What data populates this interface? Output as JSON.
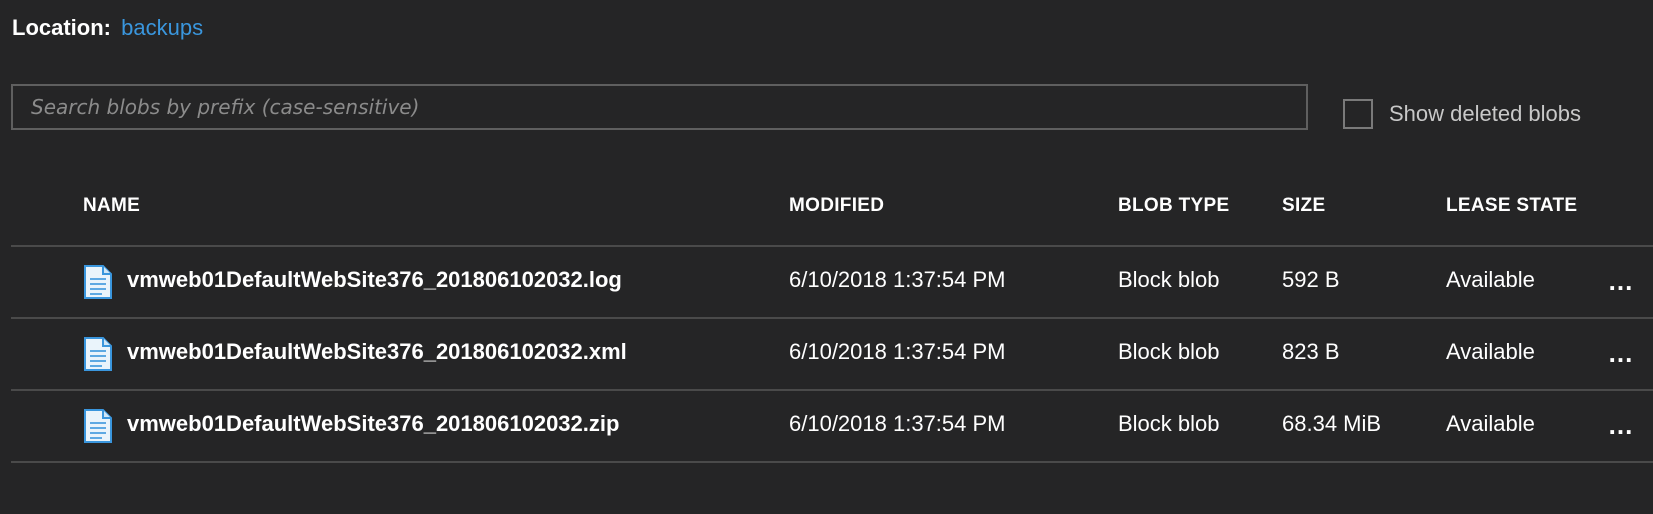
{
  "location": {
    "label": "Location:",
    "container": "backups"
  },
  "search": {
    "placeholder": "Search blobs by prefix (case-sensitive)",
    "value": ""
  },
  "show_deleted": {
    "label": "Show deleted blobs",
    "checked": false
  },
  "columns": {
    "name": "NAME",
    "modified": "MODIFIED",
    "blob_type": "BLOB TYPE",
    "size": "SIZE",
    "lease_state": "LEASE STATE"
  },
  "rows": [
    {
      "icon": "file-icon",
      "name": "vmweb01DefaultWebSite376_201806102032.log",
      "modified": "6/10/2018 1:37:54 PM",
      "blob_type": "Block blob",
      "size": "592 B",
      "lease_state": "Available",
      "more": "..."
    },
    {
      "icon": "file-icon",
      "name": "vmweb01DefaultWebSite376_201806102032.xml",
      "modified": "6/10/2018 1:37:54 PM",
      "blob_type": "Block blob",
      "size": "823 B",
      "lease_state": "Available",
      "more": "..."
    },
    {
      "icon": "file-icon",
      "name": "vmweb01DefaultWebSite376_201806102032.zip",
      "modified": "6/10/2018 1:37:54 PM",
      "blob_type": "Block blob",
      "size": "68.34 MiB",
      "lease_state": "Available",
      "more": "..."
    }
  ],
  "colors": {
    "background": "#252526",
    "link": "#3a96dd",
    "border": "#4a4a4a",
    "icon": "#3a96dd"
  }
}
